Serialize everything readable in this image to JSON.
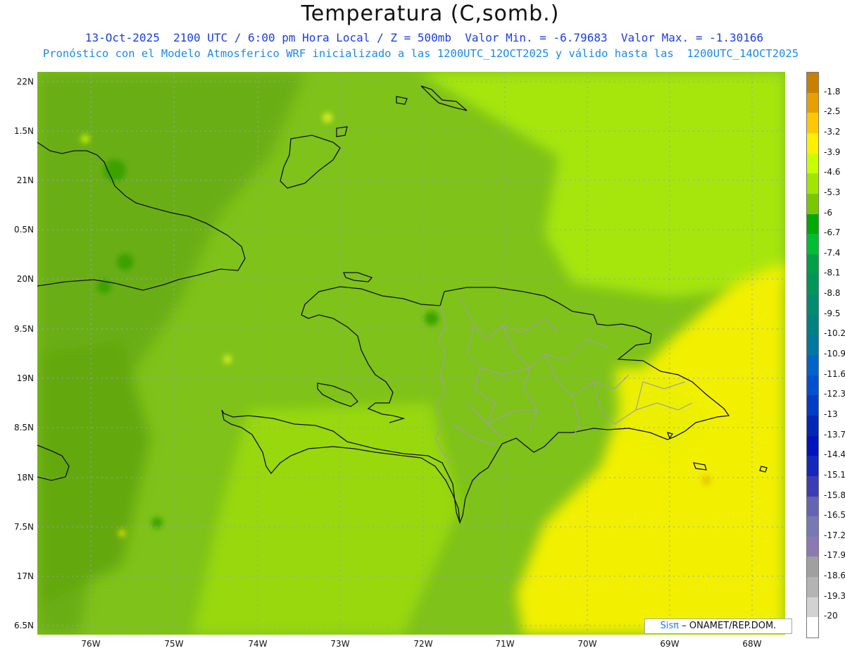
{
  "title": "Temperatura (C,somb.)",
  "subtitle_line1": "13-Oct-2025  2100 UTC / 6:00 pm Hora Local / Z = 500mb  Valor Min. = -6.79683  Valor Max. = -1.30166",
  "subtitle_line2": "Pronóstico con el Modelo Atmosferico WRF inicializado a las 1200UTC_12OCT2025 y válido hasta las  1200UTC_14OCT2025",
  "lat_labels": [
    "22N",
    "1.5N",
    "21N",
    "0.5N",
    "20N",
    "9.5N",
    "19N",
    "8.5N",
    "18N",
    "7.5N",
    "17N",
    "6.5N"
  ],
  "lon_labels": [
    "76W",
    "75W",
    "74W",
    "73W",
    "72W",
    "71W",
    "70W",
    "69W",
    "68W"
  ],
  "colorbar": {
    "labels": [
      "-1.8",
      "-2.5",
      "-3.2",
      "-3.9",
      "-4.6",
      "-5.3",
      "-6",
      "-6.7",
      "-7.4",
      "-8.1",
      "-8.8",
      "-9.5",
      "-10.2",
      "-10.9",
      "-11.6",
      "-12.3",
      "-13",
      "-13.7",
      "-14.4",
      "-15.1",
      "-15.8",
      "-16.5",
      "-17.2",
      "-17.9",
      "-18.6",
      "-19.3",
      "-20"
    ],
    "colors": [
      "#c88000",
      "#e6a000",
      "#ffc800",
      "#fff000",
      "#c8ff00",
      "#a0e600",
      "#78c800",
      "#00aa00",
      "#00be32",
      "#00a046",
      "#00965a",
      "#008c6e",
      "#008282",
      "#0078a0",
      "#0064c8",
      "#0050d2",
      "#003cc8",
      "#0028b4",
      "#0014be",
      "#1428be",
      "#3c3cb4",
      "#6464b4",
      "#7878b4",
      "#8c78b4",
      "#a0a0a0",
      "#b4b4b4",
      "#d2d2d2",
      "#ffffff"
    ]
  },
  "credit": {
    "brand": "Sisπ",
    "text": "– ONAMET/REP.DOM."
  }
}
